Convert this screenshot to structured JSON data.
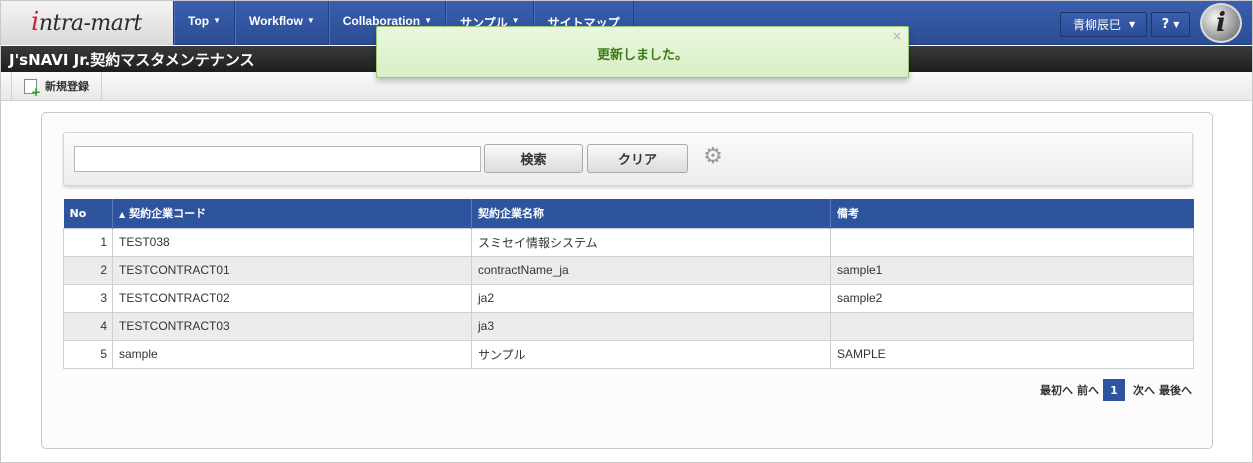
{
  "header": {
    "logo_prefix": "i",
    "logo_text": "ntra-mart",
    "nav": [
      {
        "label": "Top"
      },
      {
        "label": "Workflow"
      },
      {
        "label": "Collaboration"
      },
      {
        "label": "サンプル"
      },
      {
        "label": "サイトマップ"
      }
    ],
    "user_name": "青柳辰巳",
    "help_label": "?",
    "emblem_letter": "i"
  },
  "page": {
    "title": "J'sNAVI Jr.契約マスタメンテナンス"
  },
  "toolbar": {
    "new_label": "新規登録"
  },
  "search": {
    "value": "",
    "placeholder": "",
    "search_label": "検索",
    "clear_label": "クリア"
  },
  "table": {
    "columns": [
      "No",
      "契約企業コード",
      "契約企業名称",
      "備考"
    ],
    "sorted_column": 1,
    "rows": [
      {
        "no": "1",
        "code": "TEST038",
        "name": "スミセイ情報システム",
        "note": ""
      },
      {
        "no": "2",
        "code": "TESTCONTRACT01",
        "name": "contractName_ja",
        "note": "sample1"
      },
      {
        "no": "3",
        "code": "TESTCONTRACT02",
        "name": "ja2",
        "note": "sample2"
      },
      {
        "no": "4",
        "code": "TESTCONTRACT03",
        "name": "ja3",
        "note": ""
      },
      {
        "no": "5",
        "code": "sample",
        "name": "サンプル",
        "note": "SAMPLE"
      }
    ]
  },
  "pager": {
    "first": "最初へ",
    "prev": "前へ",
    "current": "1",
    "next": "次へ",
    "last": "最後へ"
  },
  "toast": {
    "message": "更新しました。",
    "close": "×"
  },
  "colors": {
    "nav_blue": "#2e549d",
    "toast_green_text": "#3d7a1c",
    "toast_bg": "#dff2cf"
  }
}
